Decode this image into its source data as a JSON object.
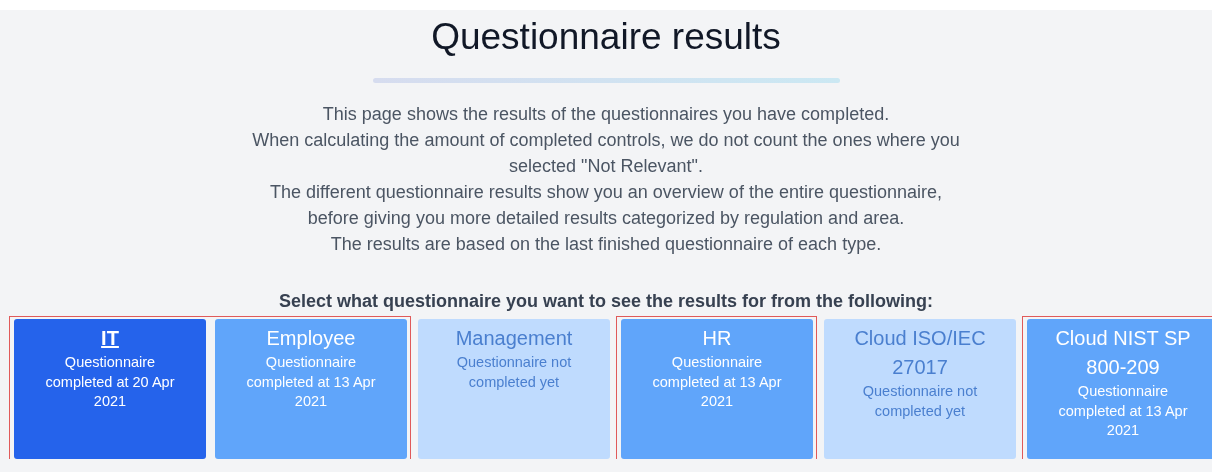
{
  "title": "Questionnaire results",
  "intro_lines": [
    "This page shows the results of the questionnaires you have completed.",
    "When calculating the amount of completed controls, we do not count the ones where you",
    "selected \"Not Relevant\".",
    "The different questionnaire results show you an overview of the entire questionnaire,",
    "before giving you more detailed results categorized by regulation and area.",
    "The results are based on the last finished questionnaire of each type."
  ],
  "prompt": "Select what questionnaire you want to see the results for from the following:",
  "card_groups": [
    {
      "outlined": true,
      "cards": [
        {
          "name": "IT",
          "status": "Questionnaire completed at 20 Apr 2021",
          "completed": true,
          "selected": true
        },
        {
          "name": "Employee",
          "status": "Questionnaire completed at 13 Apr 2021",
          "completed": true,
          "selected": false
        }
      ]
    },
    {
      "outlined": false,
      "cards": [
        {
          "name": "Management",
          "status": "Questionnaire not completed yet",
          "completed": false,
          "selected": false
        }
      ]
    },
    {
      "outlined": true,
      "cards": [
        {
          "name": "HR",
          "status": "Questionnaire completed at 13 Apr 2021",
          "completed": true,
          "selected": false
        }
      ]
    },
    {
      "outlined": false,
      "cards": [
        {
          "name": "Cloud ISO/IEC 27017",
          "status": "Questionnaire not completed yet",
          "completed": false,
          "selected": false
        }
      ]
    },
    {
      "outlined": true,
      "cards": [
        {
          "name": "Cloud NIST SP 800-209",
          "status": "Questionnaire completed at 13 Apr 2021",
          "completed": true,
          "selected": false
        }
      ]
    }
  ]
}
